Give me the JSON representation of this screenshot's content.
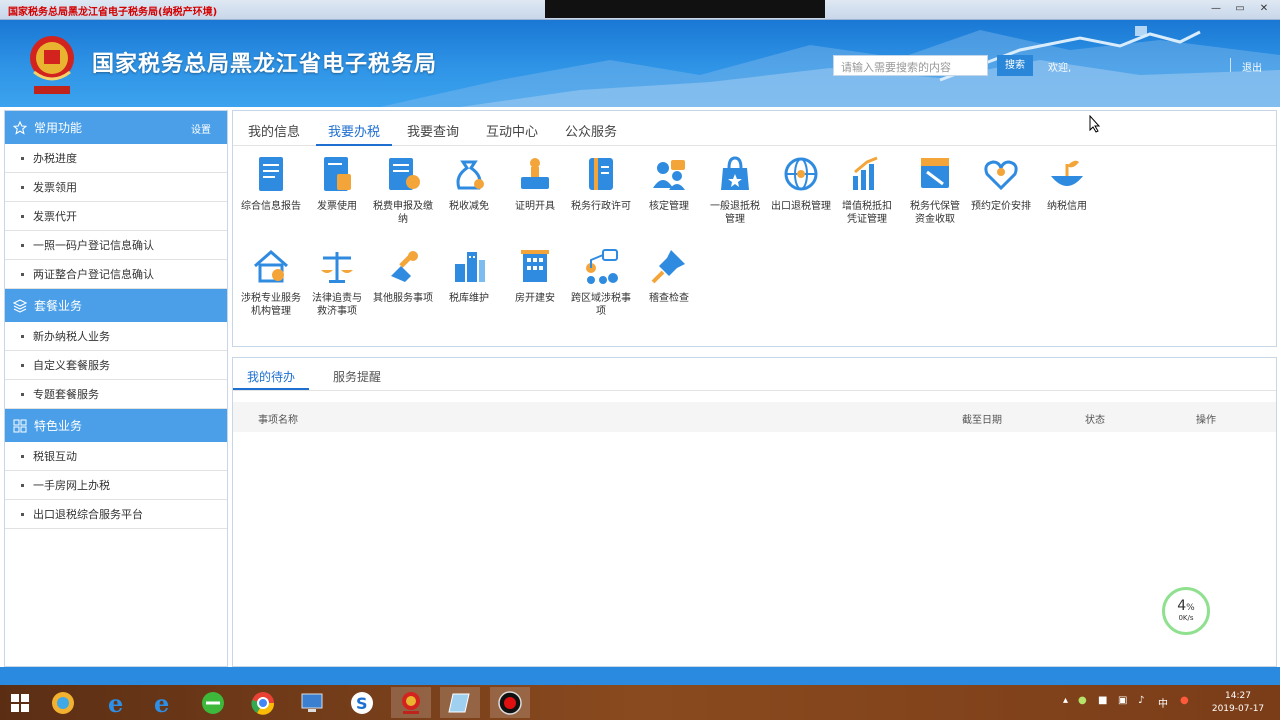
{
  "window": {
    "title": "国家税务总局黑龙江省电子税务局(纳税产环境)",
    "controls": [
      "minimize-icon",
      "maximize-icon",
      "close-icon"
    ]
  },
  "header": {
    "site_title": "国家税务总局黑龙江省电子税务局",
    "search_placeholder": "请输入需要搜索的内容",
    "search_button": "搜索",
    "welcome": "欢迎,",
    "logout": "退出"
  },
  "sidebar": {
    "groups": [
      {
        "title": "常用功能",
        "settings": "设置",
        "icon": "star-icon",
        "items": [
          "办税进度",
          "发票领用",
          "发票代开",
          "一照一码户登记信息确认",
          "两证整合户登记信息确认"
        ]
      },
      {
        "title": "套餐业务",
        "icon": "layers-icon",
        "items": [
          "新办纳税人业务",
          "自定义套餐服务",
          "专题套餐服务"
        ]
      },
      {
        "title": "特色业务",
        "icon": "grid-icon",
        "items": [
          "税银互动",
          "一手房网上办税",
          "出口退税综合服务平台"
        ]
      }
    ]
  },
  "main": {
    "tabs": [
      "我的信息",
      "我要办税",
      "我要查询",
      "互动中心",
      "公众服务"
    ],
    "active_tab": "我要办税",
    "icons": [
      [
        "综合信息报告"
      ],
      [
        "发票使用"
      ],
      [
        "税费申报及缴纳"
      ],
      [
        "税收减免"
      ],
      [
        "证明开具"
      ],
      [
        "税务行政许可"
      ],
      [
        "核定管理"
      ],
      [
        "一般退抵税",
        "管理"
      ],
      [
        "出口退税管理"
      ],
      [
        "增值税抵扣",
        "凭证管理"
      ],
      [
        "税务代保管",
        "资金收取"
      ],
      [
        "预约定价安排"
      ],
      [
        "纳税信用"
      ],
      [
        "涉税专业服务",
        "机构管理"
      ],
      [
        "法律追责与",
        "救济事项"
      ],
      [
        "其他服务事项"
      ],
      [
        "税库维护"
      ],
      [
        "房开建安"
      ],
      [
        "跨区域涉税事项"
      ],
      [
        "稽查检查"
      ]
    ]
  },
  "todo": {
    "tabs": [
      "我的待办",
      "服务提醒"
    ],
    "columns": [
      "事项名称",
      "截至日期",
      "状态",
      "操作"
    ]
  },
  "gauge": {
    "percent": "4",
    "percent_sign": "%",
    "speed": "0K/s"
  },
  "taskbar": {
    "apps": [
      "windows-start-icon",
      "360-icon",
      "ie-icon",
      "ie-icon",
      "360-browser-icon",
      "chrome-icon",
      "computer-icon",
      "sogou-icon",
      "tax-emblem-icon",
      "notebook-icon",
      "record-icon"
    ],
    "time": "14:27",
    "date": "2019-07-17",
    "ime": "中"
  }
}
